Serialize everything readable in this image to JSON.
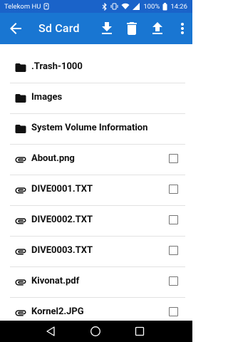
{
  "statusbar": {
    "carrier": "Telekom HU",
    "battery": "100%",
    "time": "14:26"
  },
  "appbar": {
    "title": "Sd Card"
  },
  "files": [
    {
      "name": ".Trash-1000",
      "type": "folder"
    },
    {
      "name": "Images",
      "type": "folder"
    },
    {
      "name": "System Volume Information",
      "type": "folder"
    },
    {
      "name": "About.png",
      "type": "file"
    },
    {
      "name": "DIVE0001.TXT",
      "type": "file"
    },
    {
      "name": "DIVE0002.TXT",
      "type": "file"
    },
    {
      "name": "DIVE0003.TXT",
      "type": "file"
    },
    {
      "name": "Kivonat.pdf",
      "type": "file"
    },
    {
      "name": "Kornel2.JPG",
      "type": "file"
    }
  ],
  "colors": {
    "appbar": "#1976d2",
    "statusbar": "#1a63c9",
    "navbar": "#000000"
  }
}
